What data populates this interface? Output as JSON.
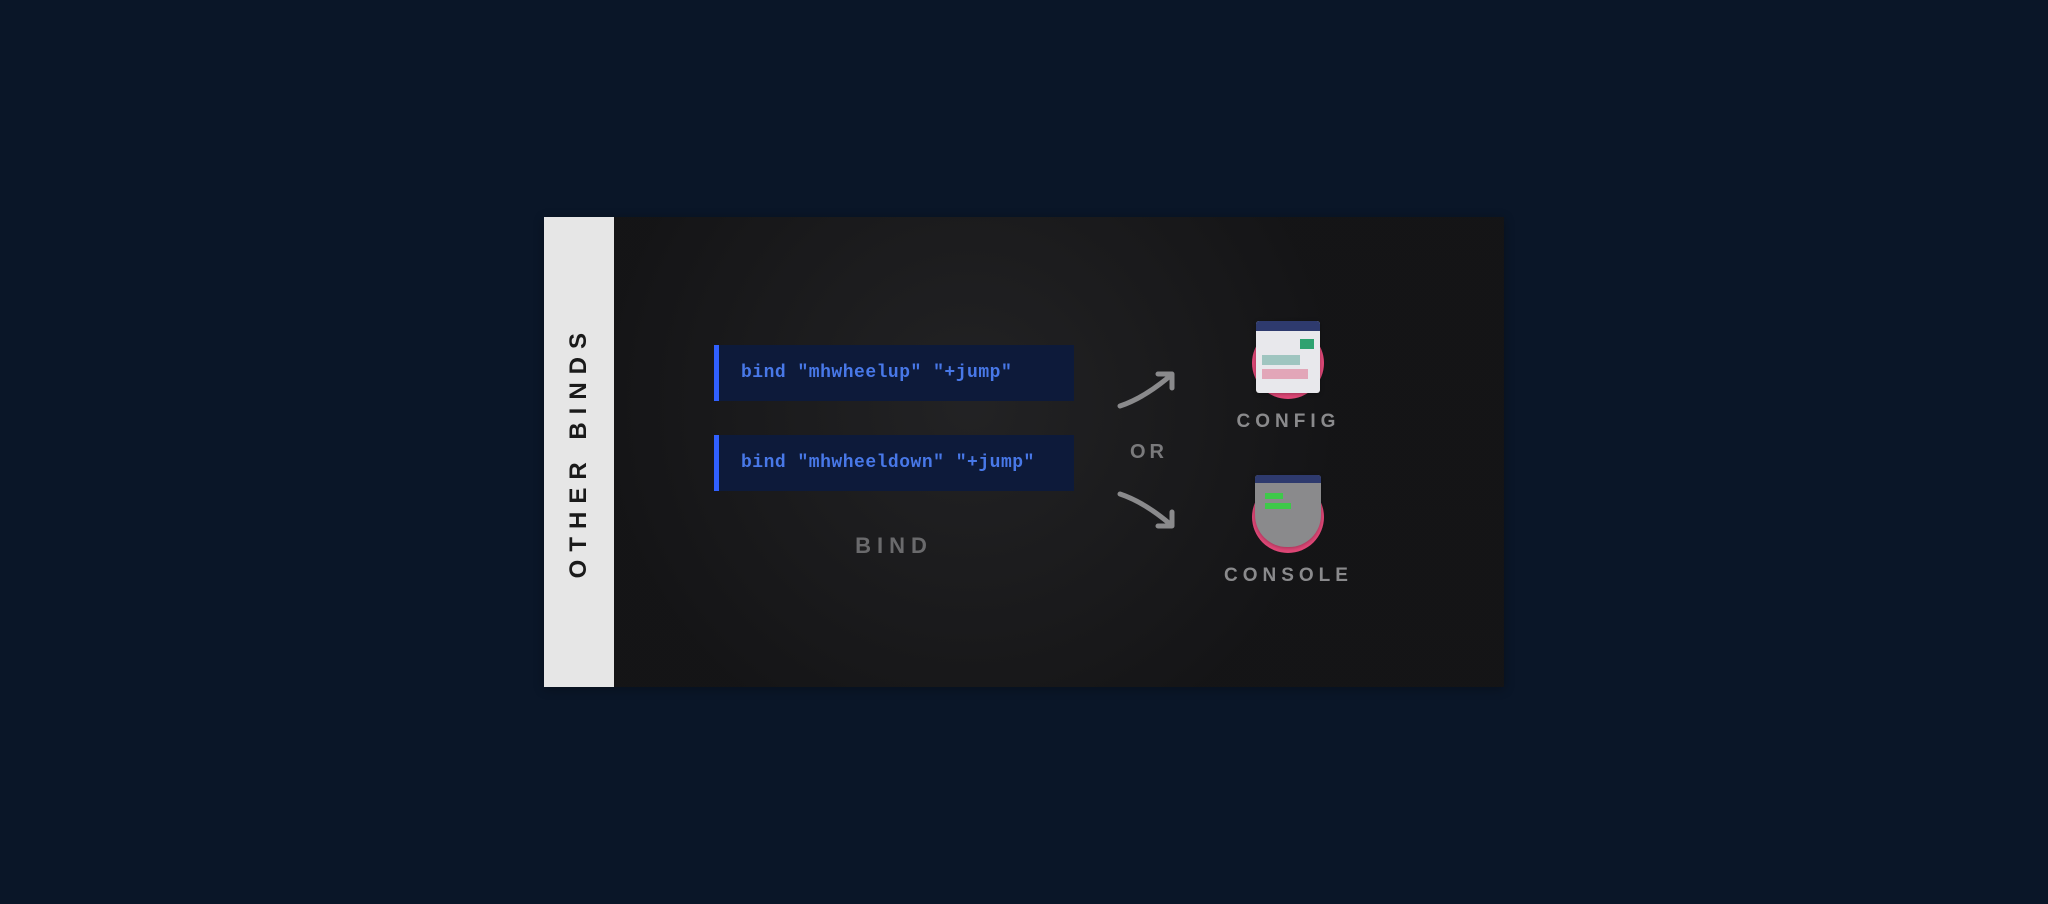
{
  "sidebar": {
    "title": "OTHER BINDS"
  },
  "binds": {
    "items": [
      {
        "code": "bind \"mhwheelup\" \"+jump\""
      },
      {
        "code": "bind \"mhwheeldown\" \"+jump\""
      }
    ],
    "label": "BIND"
  },
  "connector": {
    "or_label": "OR"
  },
  "targets": {
    "config": {
      "label": "CONFIG"
    },
    "console": {
      "label": "CONSOLE"
    }
  }
}
